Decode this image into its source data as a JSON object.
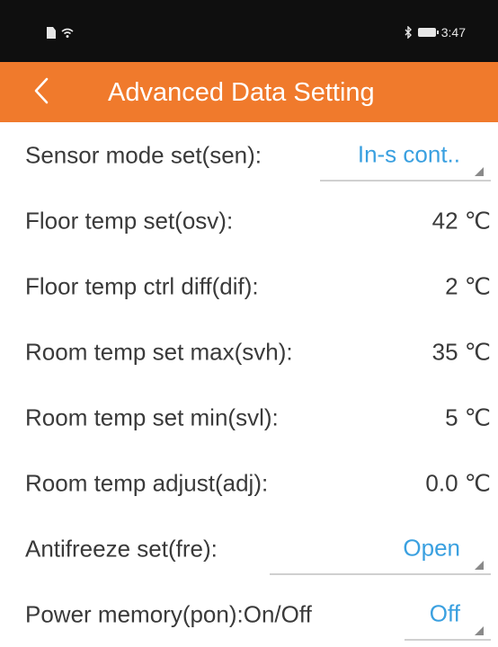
{
  "status_bar": {
    "time": "3:47",
    "icons": [
      "sim-icon",
      "wifi-icon",
      "bluetooth-icon",
      "battery-icon"
    ]
  },
  "header": {
    "title": "Advanced Data Setting",
    "back_icon": "chevron-left-icon",
    "background_color": "#f07a2c"
  },
  "settings": {
    "sensor_mode": {
      "label": "Sensor mode set(sen):",
      "value": "In-s cont.."
    },
    "floor_temp": {
      "label": "Floor temp set(osv):",
      "value": "42 ℃"
    },
    "floor_diff": {
      "label": "Floor temp ctrl diff(dif):",
      "value": "2 ℃"
    },
    "room_max": {
      "label": "Room temp set max(svh):",
      "value": "35 ℃"
    },
    "room_min": {
      "label": "Room temp set min(svl):",
      "value": "5 ℃"
    },
    "room_adjust": {
      "label": "Room temp adjust(adj):",
      "value": "0.0 ℃"
    },
    "antifreeze": {
      "label": "Antifreeze set(fre):",
      "value": "Open"
    },
    "power_memory": {
      "label": "Power memory(pon):On/Off",
      "value": "Off"
    }
  },
  "colors": {
    "accent": "#f07a2c",
    "link_value": "#3aa0e0",
    "text": "#3a3a3a",
    "status_bar": "#0f0f0f"
  }
}
